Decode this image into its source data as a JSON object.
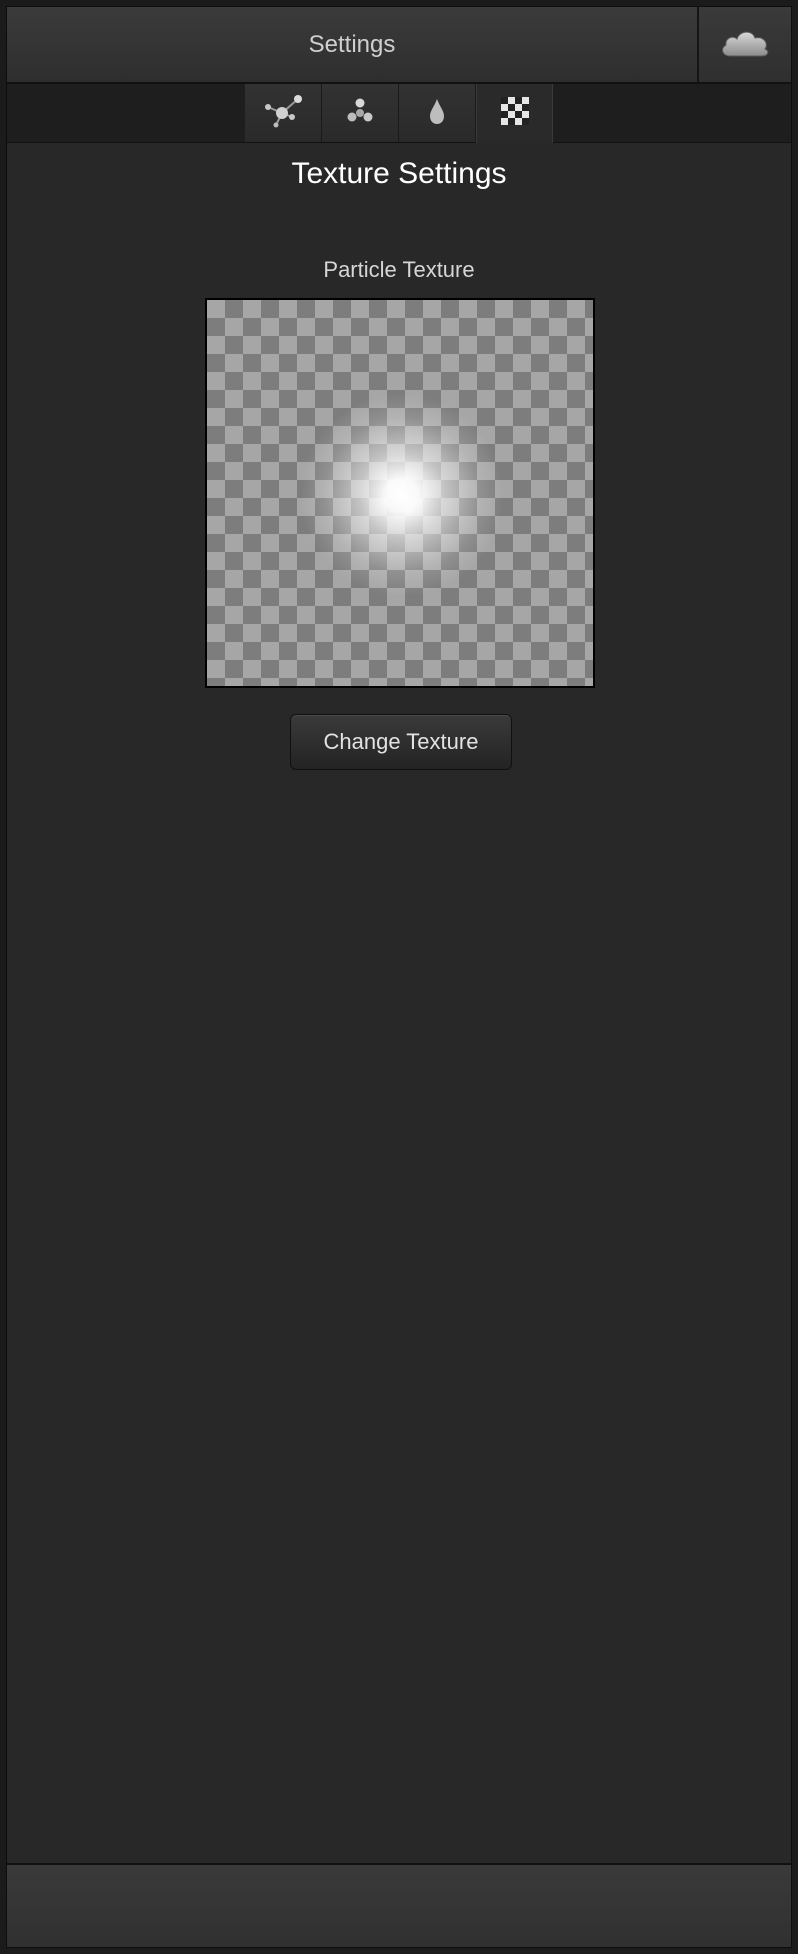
{
  "titlebar": {
    "title": "Settings",
    "cloud_icon": "cloud-icon"
  },
  "tabs": [
    {
      "icon": "molecule-icon",
      "active": false
    },
    {
      "icon": "atom-cluster-icon",
      "active": false
    },
    {
      "icon": "drop-icon",
      "active": false
    },
    {
      "icon": "checkerboard-icon",
      "active": true
    }
  ],
  "main": {
    "heading": "Texture Settings",
    "texture_label": "Particle Texture",
    "change_button_label": "Change Texture"
  },
  "colors": {
    "background": "#282828",
    "titlebar": "#353535",
    "text": "#ffffff"
  }
}
